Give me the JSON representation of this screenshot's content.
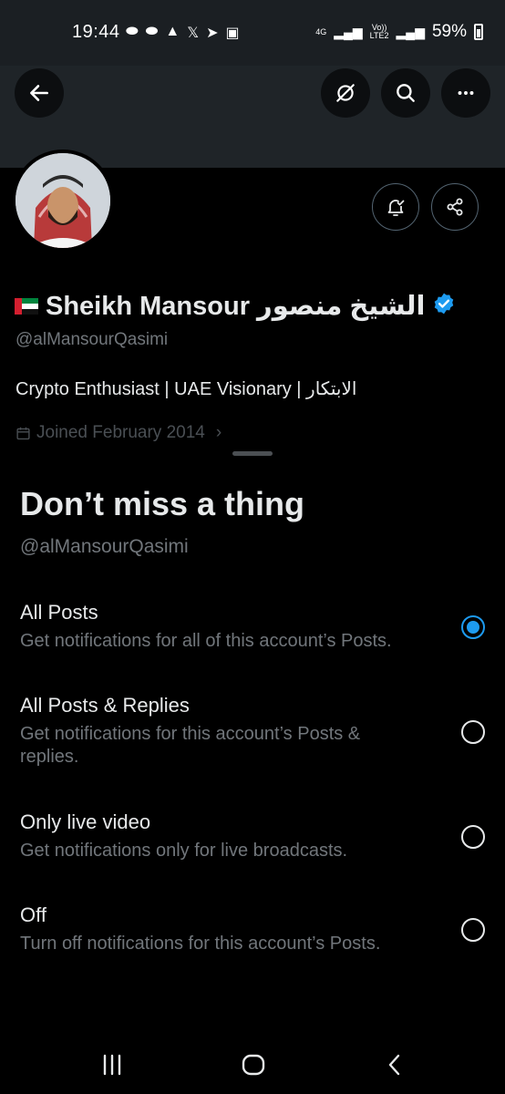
{
  "status_bar": {
    "time": "19:44",
    "network_4g": "4G",
    "volte_top": "Vo))",
    "volte_bottom": "LTE2",
    "battery": "59%"
  },
  "header": {
    "back_icon": "back-arrow-icon",
    "actions": [
      "spaces-icon",
      "search-icon",
      "more-icon"
    ]
  },
  "profile": {
    "name": "Sheikh Mansour الشيخ منصور",
    "handle": "@alMansourQasimi",
    "bio": "Crypto Enthusiast | UAE Visionary | الابتكار",
    "joined": "Joined February 2014",
    "actions": [
      "notification-bell-icon",
      "share-icon"
    ]
  },
  "sheet": {
    "title": "Don’t miss a thing",
    "subtitle": "@alMansourQasimi",
    "options": [
      {
        "title": "All Posts",
        "desc": "Get notifications for all of this account’s Posts.",
        "selected": true
      },
      {
        "title": "All Posts & Replies",
        "desc": "Get notifications for this account’s Posts & replies.",
        "selected": false
      },
      {
        "title": "Only live video",
        "desc": "Get notifications only for live broadcasts.",
        "selected": false
      },
      {
        "title": "Off",
        "desc": "Turn off notifications for this account’s Posts.",
        "selected": false
      }
    ]
  },
  "colors": {
    "accent": "#1d9bf0",
    "background": "#000000",
    "muted_text": "#71767b"
  }
}
